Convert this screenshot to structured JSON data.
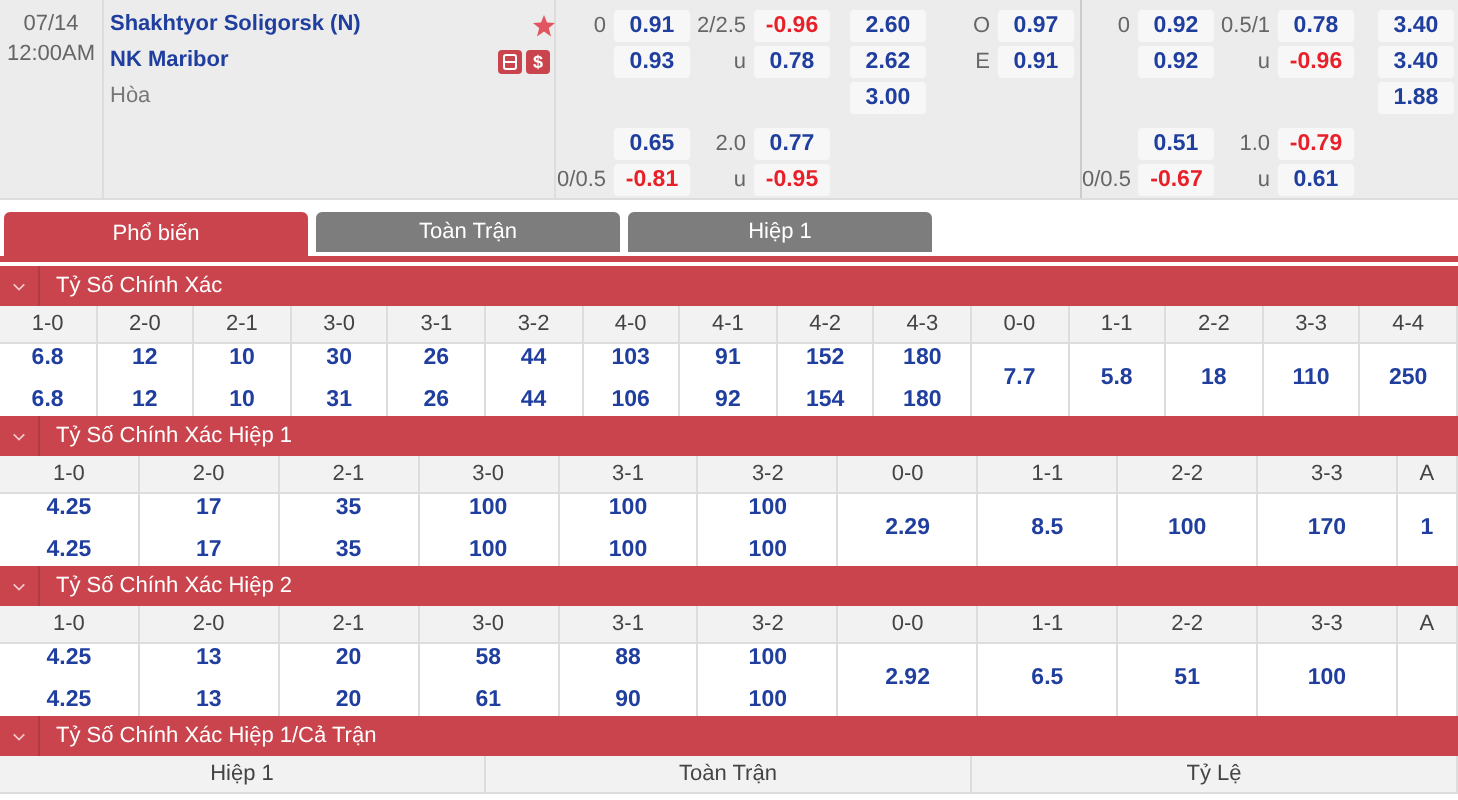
{
  "match": {
    "date": "07/14",
    "time": "12:00AM",
    "home": "Shakhtyor Soligorsk (N)",
    "away": "NK Maribor",
    "draw": "Hòa",
    "favorite": true,
    "badge_text": "$"
  },
  "odds": {
    "blocks": [
      [
        {
          "full": [
            {
              "kind": "handicap",
              "line": "0",
              "price": "0.91",
              "negative": false
            },
            {
              "kind": "total",
              "line": "2/2.5",
              "price": "-0.96",
              "negative": true
            },
            {
              "kind": "moneyline",
              "price": "2.60",
              "negative": false
            },
            {
              "kind": "parity",
              "line": "O",
              "price": "0.97",
              "negative": false
            }
          ],
          "half": [
            {
              "kind": "handicap",
              "line": "0",
              "price": "0.92",
              "negative": false
            },
            {
              "kind": "total",
              "line": "0.5/1",
              "price": "0.78",
              "negative": false
            },
            {
              "kind": "moneyline",
              "price": "3.40",
              "negative": false
            }
          ]
        },
        {
          "full": [
            {
              "kind": "handicap",
              "price": "0.93",
              "negative": false
            },
            {
              "kind": "total",
              "line": "u",
              "price": "0.78",
              "negative": false
            },
            {
              "kind": "moneyline",
              "price": "2.62",
              "negative": false
            },
            {
              "kind": "parity",
              "line": "E",
              "price": "0.91",
              "negative": false
            }
          ],
          "half": [
            {
              "kind": "handicap",
              "price": "0.92",
              "negative": false
            },
            {
              "kind": "total",
              "line": "u",
              "price": "-0.96",
              "negative": true
            },
            {
              "kind": "moneyline",
              "price": "3.40",
              "negative": false
            }
          ]
        },
        {
          "full": [
            {
              "kind": "moneyline",
              "price": "3.00",
              "negative": false
            }
          ],
          "half": [
            {
              "kind": "moneyline",
              "price": "1.88",
              "negative": false
            }
          ]
        }
      ],
      [
        {
          "full": [
            {
              "kind": "handicap",
              "price": "0.65",
              "negative": false
            },
            {
              "kind": "total",
              "line": "2.0",
              "price": "0.77",
              "negative": false
            }
          ],
          "half": [
            {
              "kind": "handicap",
              "price": "0.51",
              "negative": false
            },
            {
              "kind": "total",
              "line": "1.0",
              "price": "-0.79",
              "negative": true
            }
          ]
        },
        {
          "full": [
            {
              "kind": "handicap",
              "line": "0/0.5",
              "price": "-0.81",
              "negative": true
            },
            {
              "kind": "total",
              "line": "u",
              "price": "-0.95",
              "negative": true
            }
          ],
          "half": [
            {
              "kind": "handicap",
              "line": "0/0.5",
              "price": "-0.67",
              "negative": true
            },
            {
              "kind": "total",
              "line": "u",
              "price": "0.61",
              "negative": false
            }
          ]
        }
      ]
    ]
  },
  "tabs": [
    {
      "label": "Phổ biến",
      "selected": true
    },
    {
      "label": "Toàn Trận",
      "selected": false
    },
    {
      "label": "Hiệp 1",
      "selected": false
    }
  ],
  "sections": [
    {
      "title": "Tỷ Số Chính Xác",
      "columns": [
        {
          "label": "1-0",
          "values": [
            "6.8",
            "6.8"
          ]
        },
        {
          "label": "2-0",
          "values": [
            "12",
            "12"
          ]
        },
        {
          "label": "2-1",
          "values": [
            "10",
            "10"
          ]
        },
        {
          "label": "3-0",
          "values": [
            "30",
            "31"
          ]
        },
        {
          "label": "3-1",
          "values": [
            "26",
            "26"
          ]
        },
        {
          "label": "3-2",
          "values": [
            "44",
            "44"
          ]
        },
        {
          "label": "4-0",
          "values": [
            "103",
            "106"
          ]
        },
        {
          "label": "4-1",
          "values": [
            "91",
            "92"
          ]
        },
        {
          "label": "4-2",
          "values": [
            "152",
            "154"
          ]
        },
        {
          "label": "4-3",
          "values": [
            "180",
            "180"
          ]
        },
        {
          "label": "0-0",
          "values": [
            "7.7"
          ]
        },
        {
          "label": "1-1",
          "values": [
            "5.8"
          ]
        },
        {
          "label": "2-2",
          "values": [
            "18"
          ]
        },
        {
          "label": "3-3",
          "values": [
            "110"
          ]
        },
        {
          "label": "4-4",
          "values": [
            "250"
          ]
        }
      ]
    },
    {
      "title": "Tỷ Số Chính Xác Hiệp 1",
      "columns": [
        {
          "label": "1-0",
          "values": [
            "4.25",
            "4.25"
          ]
        },
        {
          "label": "2-0",
          "values": [
            "17",
            "17"
          ]
        },
        {
          "label": "2-1",
          "values": [
            "35",
            "35"
          ]
        },
        {
          "label": "3-0",
          "values": [
            "100",
            "100"
          ]
        },
        {
          "label": "3-1",
          "values": [
            "100",
            "100"
          ]
        },
        {
          "label": "3-2",
          "values": [
            "100",
            "100"
          ]
        },
        {
          "label": "0-0",
          "values": [
            "2.29"
          ]
        },
        {
          "label": "1-1",
          "values": [
            "8.5"
          ]
        },
        {
          "label": "2-2",
          "values": [
            "100"
          ]
        },
        {
          "label": "3-3",
          "values": [
            "170"
          ]
        },
        {
          "label": "A",
          "values": [
            "1"
          ]
        }
      ]
    },
    {
      "title": "Tỷ Số Chính Xác Hiệp 2",
      "columns": [
        {
          "label": "1-0",
          "values": [
            "4.25",
            "4.25"
          ]
        },
        {
          "label": "2-0",
          "values": [
            "13",
            "13"
          ]
        },
        {
          "label": "2-1",
          "values": [
            "20",
            "20"
          ]
        },
        {
          "label": "3-0",
          "values": [
            "58",
            "61"
          ]
        },
        {
          "label": "3-1",
          "values": [
            "88",
            "90"
          ]
        },
        {
          "label": "3-2",
          "values": [
            "100",
            "100"
          ]
        },
        {
          "label": "0-0",
          "values": [
            "2.92"
          ]
        },
        {
          "label": "1-1",
          "values": [
            "6.5"
          ]
        },
        {
          "label": "2-2",
          "values": [
            "51"
          ]
        },
        {
          "label": "3-3",
          "values": [
            "100"
          ]
        },
        {
          "label": "A"
        }
      ]
    },
    {
      "title": "Tỷ Số Chính Xác Hiệp 1/Cả Trận",
      "columns": [
        {
          "label": "Hiệp 1"
        },
        {
          "label": "Toàn Trận"
        },
        {
          "label": "Tỷ Lệ"
        }
      ]
    }
  ]
}
